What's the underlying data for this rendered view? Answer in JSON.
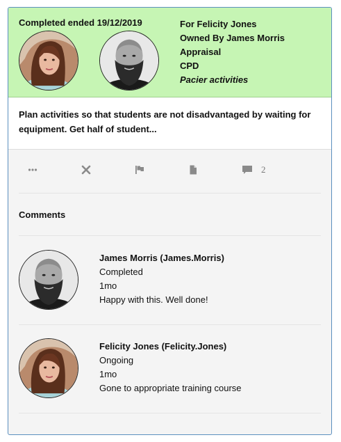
{
  "header": {
    "status": "Completed ended 19/12/2019",
    "for_line": "For Felicity Jones",
    "owner_line": "Owned By James Morris",
    "type_line": "Appraisal",
    "category_line": "CPD",
    "tag_line": "Pacier activities"
  },
  "description": "Plan activities so that students are not disadvantaged by waiting for equipment. Get half of student...",
  "actions": {
    "icons": [
      "more-icon",
      "close-icon",
      "flag-icon",
      "document-icon",
      "comment-icon"
    ],
    "comment_count": "2"
  },
  "comments_section": {
    "title": "Comments",
    "items": [
      {
        "author": "James Morris (James.Morris)",
        "status": "Completed",
        "time": "1mo",
        "text": "Happy with  this. Well done!"
      },
      {
        "author": "Felicity Jones (Felicity.Jones)",
        "status": "Ongoing",
        "time": "1mo",
        "text": "Gone to appropriate training course"
      }
    ]
  },
  "colors": {
    "header_bg": "#c6f5b4",
    "card_border": "#5b8fbf",
    "icon_gray": "#8a8a8a"
  }
}
